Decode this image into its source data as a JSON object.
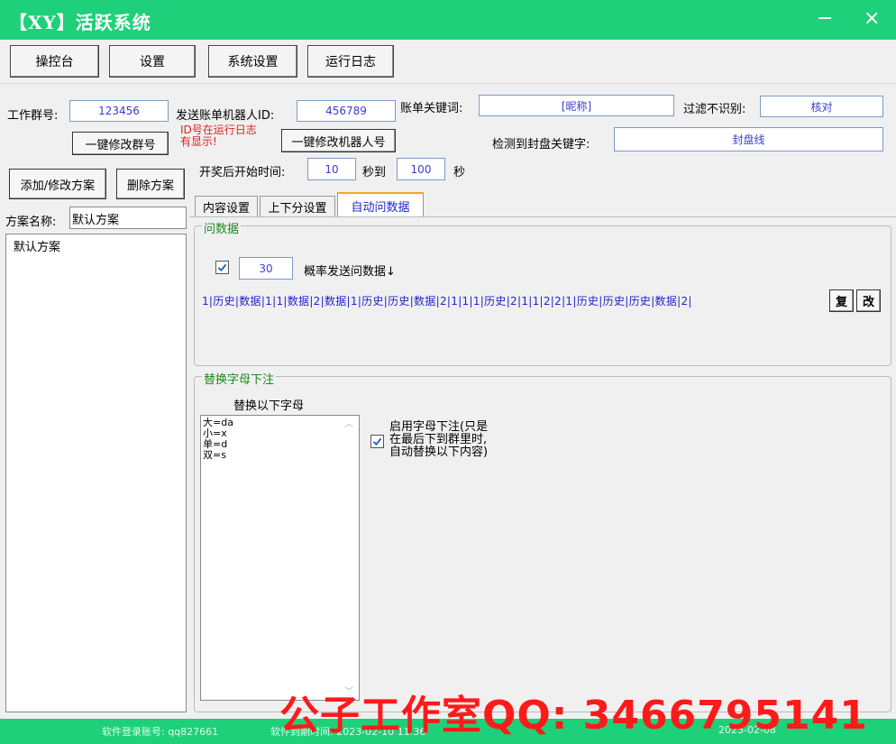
{
  "window": {
    "title": "【XY】活跃系统",
    "minimize": "−",
    "close": "×"
  },
  "toolbar": {
    "buttons": [
      "操控台",
      "设置",
      "系统设置",
      "运行日志"
    ]
  },
  "form": {
    "group_no_label": "工作群号:",
    "group_no_value": "123456",
    "bot_id_label": "发送账单机器人ID:",
    "bot_id_value": "456789",
    "bill_keyword_label": "账单关键词:",
    "bill_keyword_value": "[昵称]",
    "filter_label": "过滤不识别:",
    "filter_value": "核对",
    "modify_group_btn": "一键修改群号",
    "id_hint_line1": "ID号在运行日志",
    "id_hint_line2": "有显示!",
    "modify_bot_btn": "一键修改机器人号",
    "seal_keyword_label": "检测到封盘关键字:",
    "seal_keyword_value": "封盘线",
    "start_time_label": "开奖后开始时间:",
    "start_from": "10",
    "sec_to_label": "秒到",
    "start_to": "100",
    "sec_label": "秒"
  },
  "left_panel": {
    "add_btn": "添加/修改方案",
    "delete_btn": "删除方案",
    "plan_name_label": "方案名称:",
    "plan_name_value": "默认方案",
    "plans": [
      "默认方案"
    ]
  },
  "tabs": [
    {
      "label": "内容设置",
      "active": false
    },
    {
      "label": "上下分设置",
      "active": false
    },
    {
      "label": "自动问数据",
      "active": true
    }
  ],
  "ask_data": {
    "group_title": "问数据",
    "checked": true,
    "probability": "30",
    "probability_label": "概率发送问数据↓",
    "sequence": "1|历史|数据|1|1|数据|2|数据|1|历史|历史|数据|2|1|1|1|历史|2|1|1|2|2|1|历史|历史|历史|数据|2|",
    "reset_btn": "复",
    "edit_btn": "改"
  },
  "replace": {
    "group_title": "替换字母下注",
    "subtitle": "替换以下字母",
    "lines": [
      "大=da",
      "小=x",
      "单=d",
      "双=s"
    ],
    "enable_checked": true,
    "enable_text_line1": "启用字母下注(只是",
    "enable_text_line2": "在最后下到群里时,",
    "enable_text_line3": "自动替换以下内容)"
  },
  "status": {
    "account_text": "软件登录账号: qq827661",
    "expire_text": "软件到期时间: 2023-02-10 11:36",
    "right_text": "2023-02-08"
  },
  "watermark": "公子工作室QQ: 3466795141",
  "colors": {
    "accent_green": "#1fd07a",
    "value_blue": "#3b3bd4",
    "hint_red": "#e02020",
    "group_title_green": "#1a8a1a",
    "watermark_red": "#ff1a1a"
  }
}
